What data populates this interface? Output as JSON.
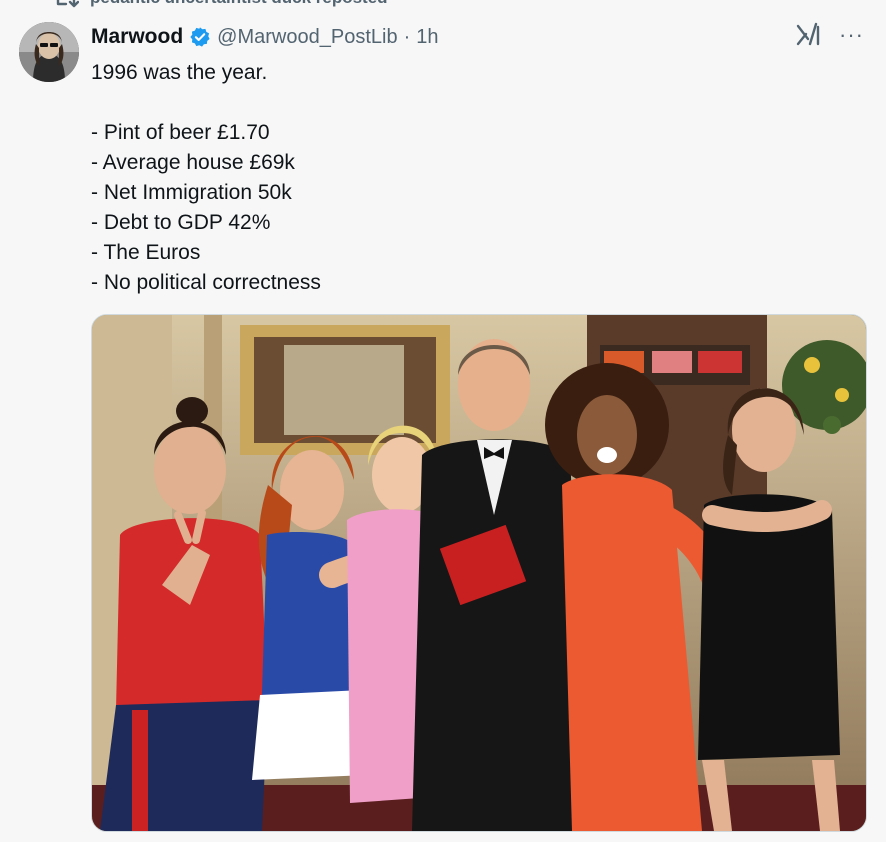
{
  "repost": {
    "label": "pedantic uncertaintist duck reposted",
    "icon": "repost-icon"
  },
  "tweet": {
    "author_name": "Marwood",
    "handle": "@Marwood_PostLib",
    "separator": "·",
    "time": "1h",
    "verified": true,
    "lines": [
      "1996 was the year.",
      "",
      "- Pint of beer £1.70",
      "- Average house £69k",
      "- Net Immigration 50k",
      "- Debt to GDP 42%",
      "- The Euros",
      "- No political correctness"
    ]
  },
  "icons": {
    "grok": "grok-icon",
    "more": "more-options-icon",
    "verified": "verified-badge-icon",
    "more_glyph": "···"
  },
  "colors": {
    "verified": "#1d9bf0",
    "secondary_text": "#536471",
    "background": "#f7f7f7"
  }
}
